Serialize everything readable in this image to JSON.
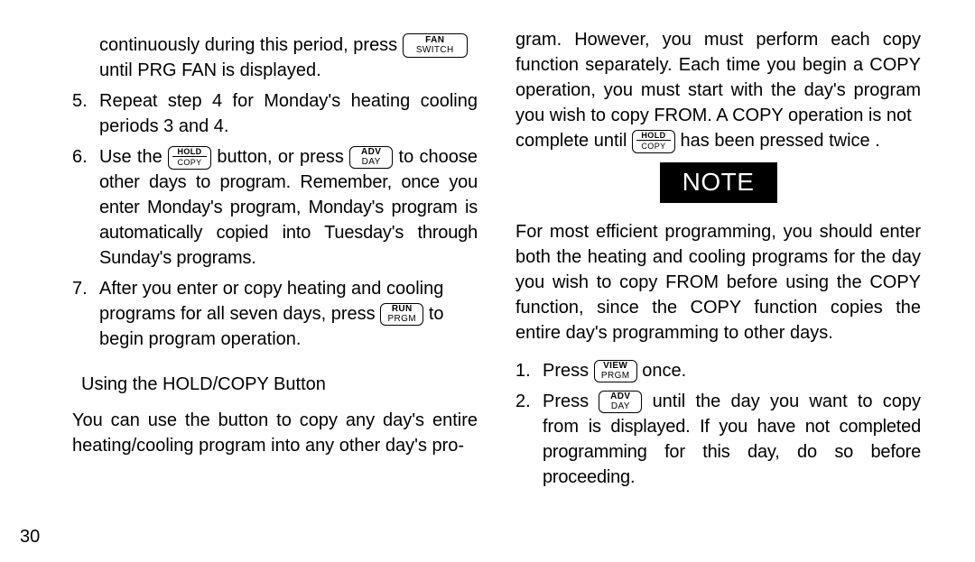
{
  "pageNumber": "30",
  "buttons": {
    "fanSwitch": {
      "top": "FAN",
      "bottom": "SWITCH"
    },
    "holdCopy": {
      "top": "HOLD",
      "bottom": "COPY"
    },
    "advDay": {
      "top": "ADV",
      "bottom": "DAY"
    },
    "runPrgm": {
      "top": "RUN",
      "bottom": "PRGM"
    },
    "viewPrgm": {
      "top": "VIEW",
      "bottom": "PRGM"
    }
  },
  "left": {
    "line1_pre": "continuously during this period, press",
    "line1_post": "until PRG FAN is displayed.",
    "item5_num": "5.",
    "item5_body": "Repeat step 4 for Monday's heating cooling periods 3 and 4.",
    "item6_num": "6.",
    "item6_pre": "Use the",
    "item6_mid": "button, or press",
    "item6_post": "to choose",
    "item6_rest": "other days to program.  Remember, once you enter Monday's program, Monday's program is automatically copied into Tuesday's through Sunday's programs.",
    "item7_num": "7.",
    "item7_a": "After you enter or copy heating and cooling",
    "item7_b_pre": "programs for all seven days, press",
    "item7_b_post": "to",
    "item7_c": "begin program operation.",
    "subheading": "Using the HOLD/COPY Button",
    "trail": "You can use the button to copy any day's entire heating/cooling program into any other day's pro-"
  },
  "right": {
    "para1_a": "gram.  However, you must perform each copy function separately.  Each time you begin a COPY operation, you must start with the day's program you wish to copy FROM.  A COPY operation is not",
    "para1_b_pre": "complete until",
    "para1_b_post": "has been pressed twice .",
    "noteLabel": "NOTE",
    "notePara": "For most efficient programming, you should enter both the heating and cooling programs for the day you wish to copy FROM before using the COPY function, since the COPY function copies the entire day's programming to other days.",
    "item1_num": "1.",
    "item1_pre": "Press",
    "item1_post": "once.",
    "item2_num": "2.",
    "item2_pre": "Press",
    "item2_mid": "until the day you want to copy from",
    "item2_rest": "is displayed.  If you have not completed programming for this day, do so before proceeding."
  }
}
